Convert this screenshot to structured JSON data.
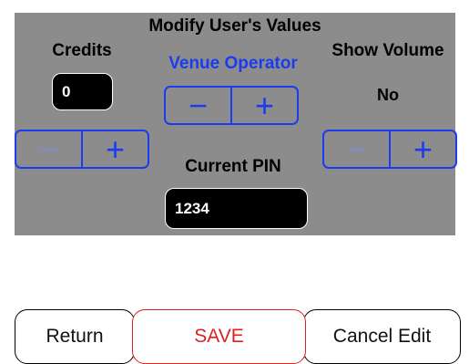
{
  "panel": {
    "title": "Modify User's Values",
    "credits": {
      "label": "Credits",
      "value": "0"
    },
    "venue_operator": {
      "label": "Venue Operator"
    },
    "show_volume": {
      "label": "Show Volume",
      "value": "No"
    },
    "current_pin": {
      "label": "Current PIN",
      "value": "1234"
    },
    "stepper": {
      "minus": "−",
      "plus": "+"
    }
  },
  "buttons": {
    "return_label": "Return",
    "save_label": "SAVE",
    "cancel_label": "Cancel Edit"
  },
  "colors": {
    "panel_bg": "#8c8c8c",
    "accent_blue": "#1a3cf0",
    "save_red": "#e02020"
  }
}
